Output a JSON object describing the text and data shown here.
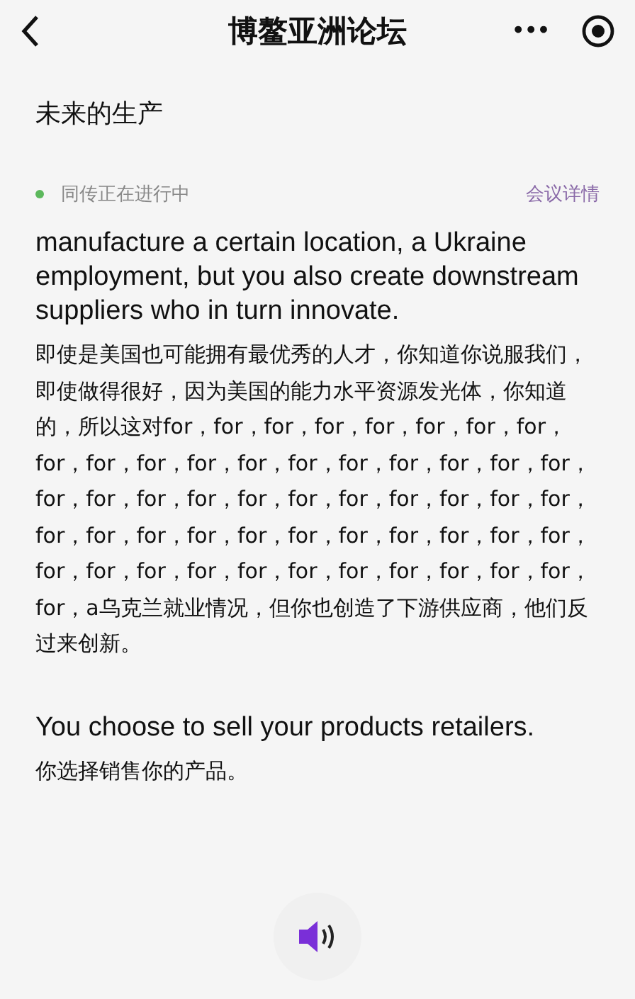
{
  "nav_bar": {
    "title": "博鳌亚洲论坛",
    "more": "•••"
  },
  "session": {
    "title": "未来的生产",
    "status": "同传正在进行中",
    "details_link": "会议详情"
  },
  "transcript": [
    {
      "english": "manufacture a certain location, a Ukraine employment, but you also create downstream suppliers who in turn innovate.",
      "chinese": "即使是美国也可能拥有最优秀的人才，你知道你说服我们，即使做得很好，因为美国的能力水平资源发光体，你知道的，所以这对for，for，for，for，for，for，for，for，for，for，for，for，for，for，for，for，for，for，for，for，for，for，for，for，for，for，for，for，for，for，for，for，for，for，for，for，for，for，for，for，for，for，for，for，for，for，for，for，for，for，for，for，for，a乌克兰就业情况，但你也创造了下游供应商，他们反过来创新。"
    },
    {
      "english": "You choose to sell your products retailers.",
      "chinese": "你选择销售你的产品。"
    }
  ],
  "audio": {
    "playing": true
  }
}
